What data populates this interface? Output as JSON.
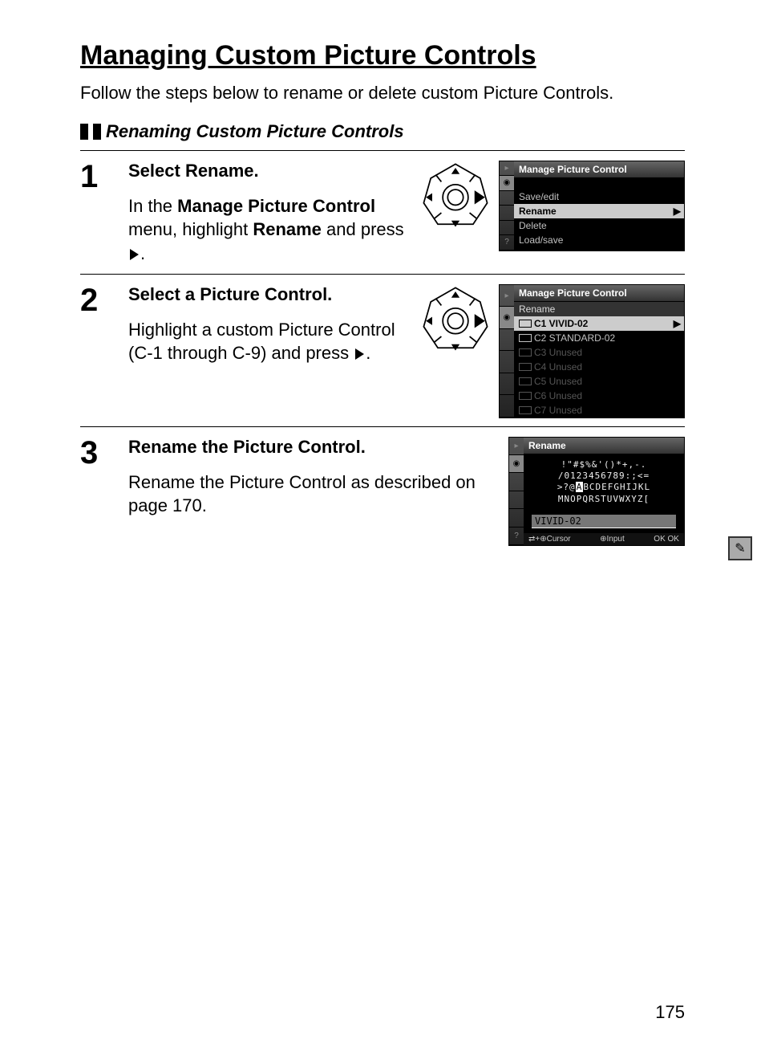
{
  "page": {
    "title": "Managing Custom Picture Controls",
    "intro": "Follow the steps below to rename or delete custom Picture Controls.",
    "subsection": "Renaming Custom Picture Controls",
    "page_number": "175"
  },
  "steps": [
    {
      "num": "1",
      "heading_plain": "Select ",
      "heading_bold": "Rename",
      "heading_end": ".",
      "desc_pre": "In the ",
      "desc_bold1": "Manage Picture Control",
      "desc_mid": " menu, highlight ",
      "desc_bold2": "Rename",
      "desc_post": " and press ",
      "desc_tail": "."
    },
    {
      "num": "2",
      "heading_plain": "Select a Picture Control.",
      "desc_full": "Highlight a custom Picture Control (C-1 through C-9) and press ",
      "desc_tail": "."
    },
    {
      "num": "3",
      "heading_plain": "Rename the Picture Control.",
      "desc_full": "Rename the Picture Control as described on page 170."
    }
  ],
  "lcd1": {
    "title": "Manage Picture Control",
    "items": [
      "Save/edit",
      "Rename",
      "Delete",
      "Load/save"
    ],
    "highlight_index": 1
  },
  "lcd2": {
    "title": "Manage Picture Control",
    "subtitle": "Rename",
    "items": [
      {
        "slot": "C1",
        "name": "VIVID-02",
        "hl": true,
        "dim": false
      },
      {
        "slot": "C2",
        "name": "STANDARD-02",
        "hl": false,
        "dim": false
      },
      {
        "slot": "C3",
        "name": "Unused",
        "hl": false,
        "dim": true
      },
      {
        "slot": "C4",
        "name": "Unused",
        "hl": false,
        "dim": true
      },
      {
        "slot": "C5",
        "name": "Unused",
        "hl": false,
        "dim": true
      },
      {
        "slot": "C6",
        "name": "Unused",
        "hl": false,
        "dim": true
      },
      {
        "slot": "C7",
        "name": "Unused",
        "hl": false,
        "dim": true
      }
    ]
  },
  "lcd3": {
    "title": "Rename",
    "char_row1": "!\"#$%&'()*+,-.",
    "char_row2": "/0123456789:;<=",
    "char_row3_pre": ">?@",
    "char_row3_cursor": "A",
    "char_row3_post": "BCDEFGHIJKL",
    "char_row4": "MNOPQRSTUVWXYZ[",
    "input_value": "VIVID-02",
    "footer_left": "⇄+⊕Cursor",
    "footer_mid": "⊕Input",
    "footer_right": "OK OK"
  }
}
